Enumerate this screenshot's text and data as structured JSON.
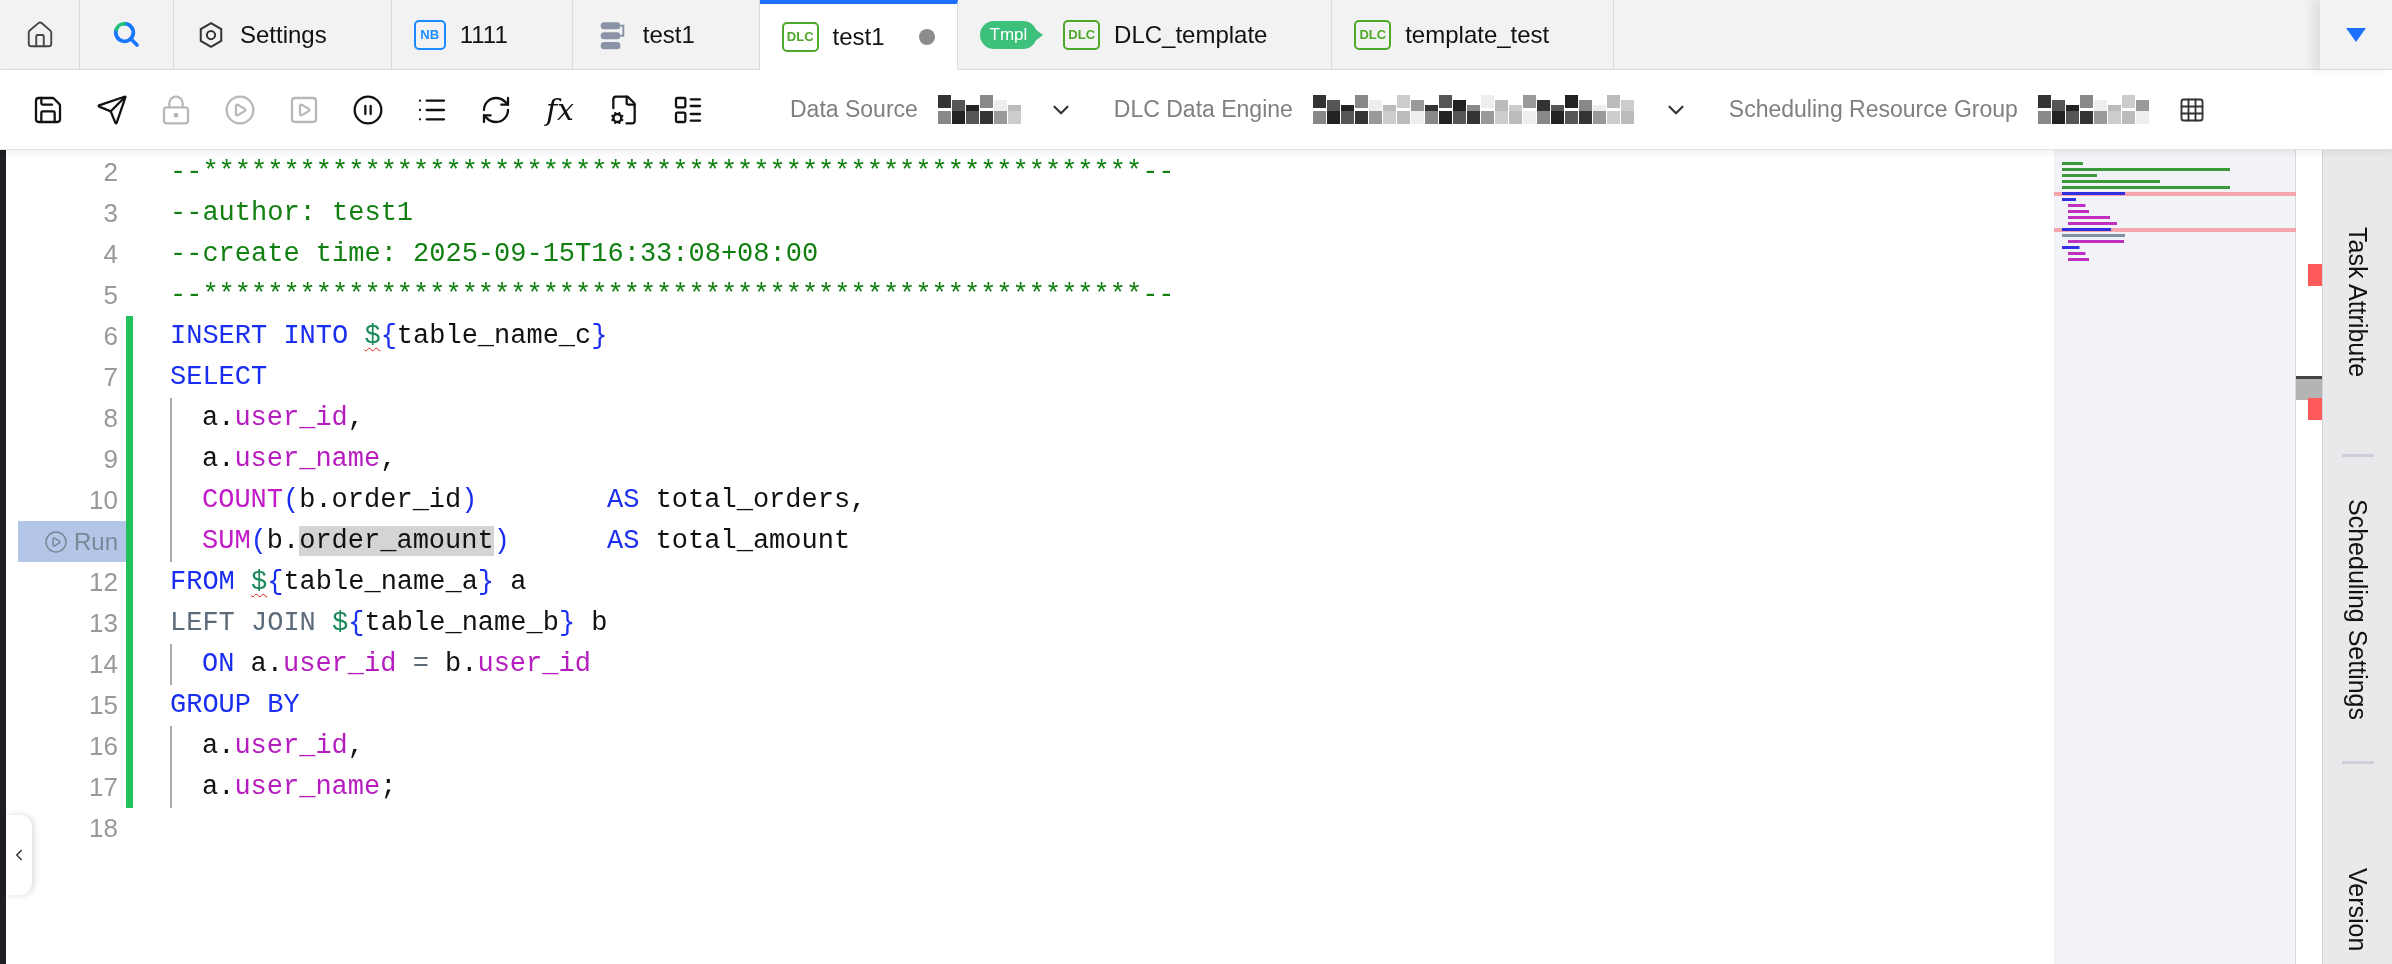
{
  "tabs": [
    {
      "kind": "home",
      "selected": false,
      "modified": false
    },
    {
      "kind": "search",
      "selected": false,
      "modified": false
    },
    {
      "kind": "settings",
      "label": "Settings",
      "selected": false,
      "modified": false
    },
    {
      "kind": "notebook",
      "badge": "NB",
      "label": "1111",
      "selected": false,
      "modified": false
    },
    {
      "kind": "workflow",
      "label": "test1",
      "selected": false,
      "modified": false
    },
    {
      "kind": "dlc",
      "badge": "DLC",
      "label": "test1",
      "selected": true,
      "modified": true
    },
    {
      "kind": "dlc",
      "tag": "Tmpl",
      "badge": "DLC",
      "label": "DLC_template",
      "selected": false,
      "modified": false
    },
    {
      "kind": "dlc",
      "badge": "DLC",
      "label": "template_test",
      "selected": false,
      "modified": false
    }
  ],
  "toolbar": {
    "tools": [
      {
        "kind": "save",
        "disabled": false
      },
      {
        "kind": "send",
        "disabled": false
      },
      {
        "kind": "lock",
        "disabled": true
      },
      {
        "kind": "run",
        "disabled": true
      },
      {
        "kind": "run-file",
        "disabled": true
      },
      {
        "kind": "pause",
        "disabled": false
      },
      {
        "kind": "format",
        "disabled": false
      },
      {
        "kind": "refresh",
        "disabled": false
      },
      {
        "kind": "function",
        "label": "fx",
        "disabled": false
      },
      {
        "kind": "config",
        "disabled": false
      },
      {
        "kind": "layout",
        "disabled": false
      }
    ],
    "fields": [
      {
        "kind": "select",
        "label": "Data Source"
      },
      {
        "kind": "select",
        "label": "DLC Data Engine"
      },
      {
        "kind": "picker",
        "label": "Scheduling Resource Group"
      }
    ]
  },
  "editor": {
    "lines": [
      {
        "number": "2",
        "modified": false,
        "indented": false,
        "tokens": [
          {
            "kind": "comment",
            "text": "--**********************************************************--"
          }
        ]
      },
      {
        "number": "3",
        "modified": false,
        "indented": false,
        "tokens": [
          {
            "kind": "comment",
            "text": "--author: test1"
          }
        ]
      },
      {
        "number": "4",
        "modified": false,
        "indented": false,
        "tokens": [
          {
            "kind": "comment",
            "text": "--create time: 2025-09-15T16:33:08+08:00"
          }
        ]
      },
      {
        "number": "5",
        "modified": false,
        "indented": false,
        "tokens": [
          {
            "kind": "comment",
            "text": "--**********************************************************--"
          }
        ]
      },
      {
        "number": "6",
        "modified": true,
        "indented": false,
        "tokens": [
          {
            "kind": "keyword",
            "text": "INSERT INTO "
          },
          {
            "kind": "variable",
            "text": "$",
            "squiggle": true
          },
          {
            "kind": "brace",
            "text": "{"
          },
          {
            "kind": "plain",
            "text": "table_name_c"
          },
          {
            "kind": "brace",
            "text": "}"
          }
        ]
      },
      {
        "number": "7",
        "modified": true,
        "indented": false,
        "tokens": [
          {
            "kind": "keyword",
            "text": "SELECT"
          }
        ]
      },
      {
        "number": "8",
        "modified": true,
        "indented": true,
        "tokens": [
          {
            "kind": "plain",
            "text": "a."
          },
          {
            "kind": "column",
            "text": "user_id"
          },
          {
            "kind": "plain",
            "text": ","
          }
        ]
      },
      {
        "number": "9",
        "modified": true,
        "indented": true,
        "tokens": [
          {
            "kind": "plain",
            "text": "a."
          },
          {
            "kind": "column",
            "text": "user_name"
          },
          {
            "kind": "plain",
            "text": ","
          }
        ]
      },
      {
        "number": "10",
        "modified": true,
        "indented": true,
        "tokens": [
          {
            "kind": "function",
            "text": "COUNT"
          },
          {
            "kind": "brace",
            "text": "("
          },
          {
            "kind": "plain",
            "text": "b.order_id"
          },
          {
            "kind": "brace",
            "text": ")"
          }
        ],
        "tail": [
          {
            "kind": "keyword",
            "text": "AS "
          },
          {
            "kind": "plain",
            "text": "total_orders,"
          }
        ]
      },
      {
        "run": "Run",
        "modified": true,
        "indented": true,
        "tokens": [
          {
            "kind": "function",
            "text": "SUM"
          },
          {
            "kind": "brace",
            "text": "("
          },
          {
            "kind": "plain",
            "text": "b."
          },
          {
            "kind": "highlight",
            "text": "order_amount"
          },
          {
            "kind": "brace",
            "text": ")"
          }
        ],
        "tail": [
          {
            "kind": "keyword",
            "text": "AS "
          },
          {
            "kind": "plain",
            "text": "total_amount"
          }
        ]
      },
      {
        "number": "12",
        "modified": true,
        "indented": false,
        "tokens": [
          {
            "kind": "keyword",
            "text": "FROM "
          },
          {
            "kind": "variable",
            "text": "$",
            "squiggle": true
          },
          {
            "kind": "brace",
            "text": "{"
          },
          {
            "kind": "plain",
            "text": "table_name_a"
          },
          {
            "kind": "brace",
            "text": "}"
          },
          {
            "kind": "plain",
            "text": " a"
          }
        ]
      },
      {
        "number": "13",
        "modified": true,
        "indented": false,
        "tokens": [
          {
            "kind": "muted",
            "text": "LEFT JOIN "
          },
          {
            "kind": "variable",
            "text": "$"
          },
          {
            "kind": "brace",
            "text": "{"
          },
          {
            "kind": "plain",
            "text": "table_name_b"
          },
          {
            "kind": "brace",
            "text": "}"
          },
          {
            "kind": "plain",
            "text": " b"
          }
        ]
      },
      {
        "number": "14",
        "modified": true,
        "indented": true,
        "tokens": [
          {
            "kind": "keyword",
            "text": "ON "
          },
          {
            "kind": "plain",
            "text": "a."
          },
          {
            "kind": "column",
            "text": "user_id"
          },
          {
            "kind": "operator",
            "text": " = "
          },
          {
            "kind": "plain",
            "text": "b."
          },
          {
            "kind": "column",
            "text": "user_id"
          }
        ]
      },
      {
        "number": "15",
        "modified": true,
        "indented": false,
        "tokens": [
          {
            "kind": "keyword",
            "text": "GROUP BY"
          }
        ]
      },
      {
        "number": "16",
        "modified": true,
        "indented": true,
        "tokens": [
          {
            "kind": "plain",
            "text": "a."
          },
          {
            "kind": "column",
            "text": "user_id"
          },
          {
            "kind": "plain",
            "text": ","
          }
        ]
      },
      {
        "number": "17",
        "modified": true,
        "indented": true,
        "tokens": [
          {
            "kind": "plain",
            "text": "a."
          },
          {
            "kind": "column",
            "text": "user_name"
          },
          {
            "kind": "plain",
            "text": ";"
          }
        ]
      },
      {
        "number": "18",
        "modified": false,
        "indented": false
      }
    ]
  },
  "side_panel": {
    "items": [
      {
        "label": "Task Attribute"
      },
      {
        "label": "Scheduling Settings"
      },
      {
        "label": "Version"
      }
    ]
  }
}
